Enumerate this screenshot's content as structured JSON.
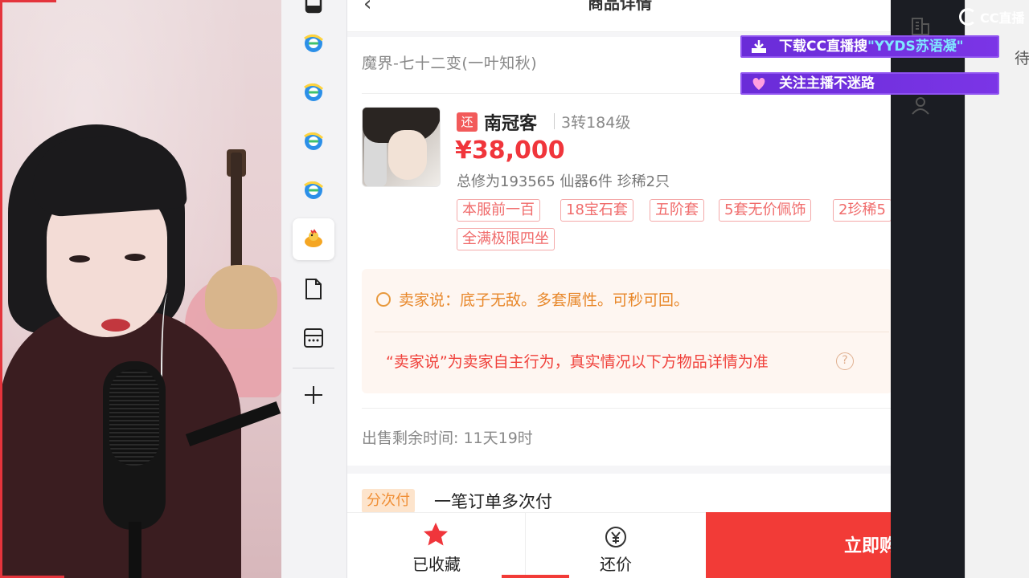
{
  "page": {
    "title": "商品详情",
    "server_name": "魔界-七十二变(一叶知秋)"
  },
  "item": {
    "return_tag": "还",
    "seller_name": "南冠客",
    "level": "3转184级",
    "price": "¥38,000",
    "stats": "总修为193565  仙器6件  珍稀2只",
    "chips": [
      "本服前一百",
      "18宝石套",
      "五阶套",
      "5套无价佩饰",
      "2珍稀5",
      "全满极限四坐"
    ]
  },
  "seller_say": {
    "label_text": "卖家说：底子无敌。多套属性。可秒可回。",
    "disclaimer": "“卖家说”为卖家自主行为，真实情况以下方物品详情为准",
    "help": "?"
  },
  "remaining_time": "出售剩余时间: 11天19时",
  "installment": {
    "badge": "分次付",
    "text": "一笔订单多次付"
  },
  "bottom_bar": {
    "favorite_label": "已收藏",
    "bargain_label": "还价",
    "buy_label": "立即购"
  },
  "overlays": {
    "download_prefix": "下载CC直播搜",
    "download_highlight": "\"YYDS苏语凝\"",
    "follow_text": "关注主播不迷路",
    "logo_text": "CC直播"
  },
  "right_panel": {
    "partial_text": "待"
  },
  "sidebar_icons": [
    "app-icon",
    "edge-icon",
    "edge-icon",
    "edge-icon",
    "edge-icon",
    "chicken-app-icon",
    "document-icon",
    "calculator-icon",
    "add-icon"
  ],
  "colors": {
    "price_red": "#f0353b",
    "buy_button": "#f23b37",
    "chip_border": "#f4a9a9",
    "overlay_purple": "#6a2cd8"
  }
}
